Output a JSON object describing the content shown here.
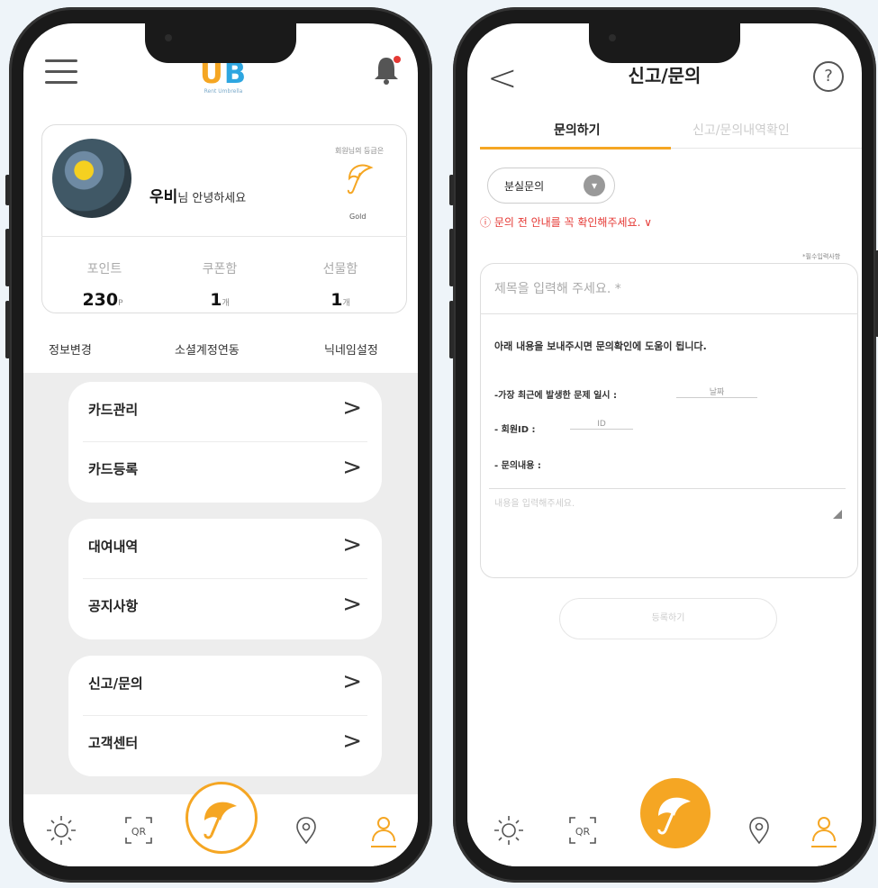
{
  "left_phone": {
    "logo": {
      "text_u": "U",
      "text_b": "B",
      "subtitle": "Rent Umbrella"
    },
    "profile": {
      "name": "우비",
      "greeting_suffix": "님 안녕하세요",
      "grade_label": "회원님의 등급은",
      "grade_name": "Gold"
    },
    "stats": [
      {
        "label": "포인트",
        "value": "230",
        "unit": "P"
      },
      {
        "label": "쿠폰함",
        "value": "1",
        "unit": "개"
      },
      {
        "label": "선물함",
        "value": "1",
        "unit": "개"
      }
    ],
    "links": [
      "정보변경",
      "소셜계정연동",
      "닉네임설정"
    ],
    "menu_groups": [
      [
        "카드관리",
        "카드등록"
      ],
      [
        "대여내역",
        "공지사항"
      ],
      [
        "신고/문의",
        "고객센터"
      ]
    ],
    "arrow": ">",
    "tabbar": {
      "weather_icon": "sun-icon",
      "qr_label": "QR",
      "map_icon": "location-pin-icon",
      "profile_icon": "person-icon"
    }
  },
  "right_phone": {
    "back": "<",
    "title": "신고/문의",
    "help": "?",
    "tabs": [
      "문의하기",
      "신고/문의내역확인"
    ],
    "select_value": "분실문의",
    "notice": "ⓘ 문의 전 안내를 꼭 확인해주세요. ∨",
    "required_note": "*필수입력사항",
    "subject_placeholder": "제목을 입력해 주세요. *",
    "guide": "아래 내용을 보내주시면 문의확인에 도움이 됩니다.",
    "field_date_label": "-가장 최근에 발생한 문제 일시 :",
    "field_date_placeholder": "날짜",
    "field_id_label": "- 회원ID :",
    "field_id_placeholder": "ID",
    "field_content_label": "- 문의내용 :",
    "content_placeholder": "내용을 입력해주세요.",
    "submit": "등록하기",
    "tabbar": {
      "qr_label": "QR"
    }
  },
  "colors": {
    "accent": "#f5a623",
    "logo_blue": "#2ea6e0",
    "alert": "#e53935"
  }
}
